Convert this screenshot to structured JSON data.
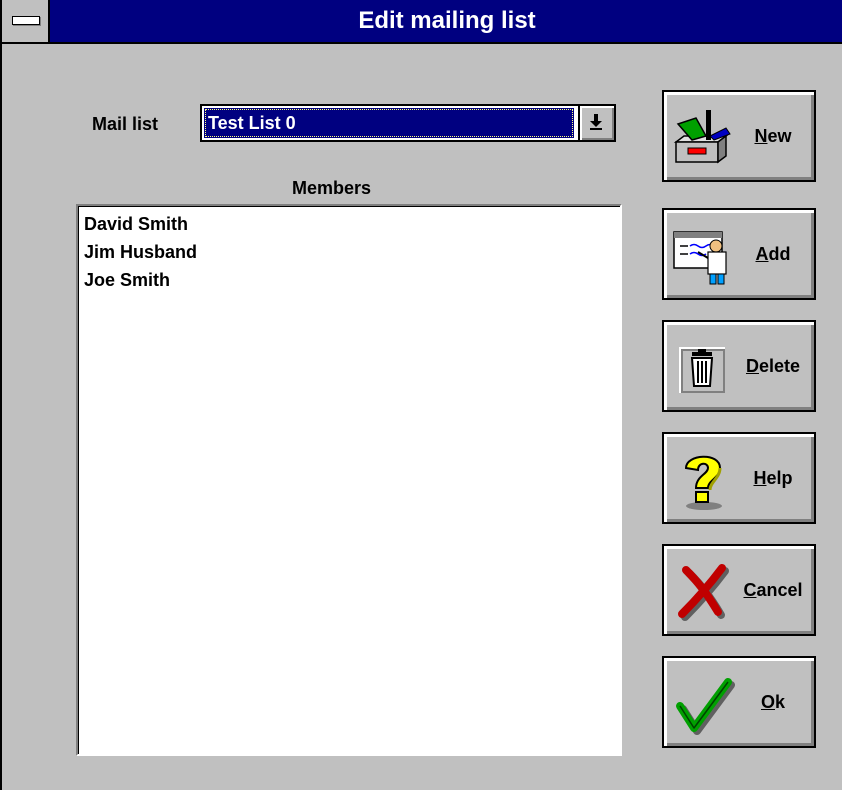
{
  "window": {
    "title": "Edit mailing list"
  },
  "mail_list": {
    "label": "Mail list",
    "selected": "Test List 0"
  },
  "members": {
    "label": "Members",
    "items": [
      "David Smith",
      "Jim Husband",
      "Joe Smith"
    ]
  },
  "buttons": {
    "new": {
      "mnemonic": "N",
      "rest": "ew"
    },
    "add": {
      "mnemonic": "A",
      "rest": "dd"
    },
    "delete": {
      "mnemonic": "D",
      "rest": "elete"
    },
    "help": {
      "mnemonic": "H",
      "rest": "elp"
    },
    "cancel": {
      "mnemonic": "C",
      "rest": "ancel"
    },
    "ok": {
      "mnemonic": "O",
      "rest": "k"
    }
  },
  "icons": {
    "new": "toolbox-icon",
    "add": "person-at-board-icon",
    "delete": "trash-can-icon",
    "help": "question-mark-icon",
    "cancel": "red-x-icon",
    "ok": "green-checkmark-icon"
  },
  "colors": {
    "titlebar": "#000080",
    "face": "#c0c0c0",
    "selection": "#000080"
  }
}
